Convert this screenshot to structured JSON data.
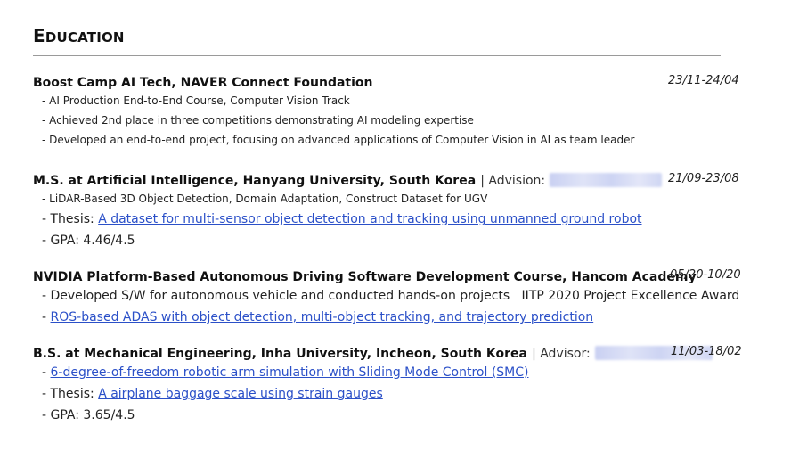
{
  "section": {
    "title_first": "E",
    "title_rest": "DUCATION"
  },
  "entries": [
    {
      "title": "Boost Camp AI Tech, NAVER Connect Foundation",
      "date": "23/11-24/04",
      "items": [
        "- AI Production End-to-End Course, Computer Vision Track",
        "- Achieved 2nd place in three competitions demonstrating AI modeling expertise",
        "- Developed an end-to-end project, focusing on advanced applications of Computer Vision in AI as team leader"
      ]
    },
    {
      "title": "M.S. at Artificial Intelligence, Hanyang University, South Korea",
      "suffix": "| Advision:",
      "date": "21/09-23/08",
      "items": [
        "- LiDAR-Based 3D Object Detection, Domain Adaptation, Construct Dataset for UGV"
      ],
      "thesis_prefix": "- Thesis:",
      "thesis_link": "A dataset for multi-sensor object detection and tracking using unmanned ground robot",
      "gpa": "- GPA: 4.46/4.5"
    },
    {
      "title": "NVIDIA Platform-Based Autonomous Driving Software Development Course, Hancom Academy",
      "date": "05/20-10/20",
      "item": "- Developed S/W for autonomous vehicle and conducted hands-on projects   IITP 2020 Project Excellence Award",
      "link_prefix": "-",
      "link": "ROS-based ADAS with object detection, multi-object tracking, and trajectory prediction"
    },
    {
      "title": "B.S. at Mechanical Engineering, Inha University, Incheon, South Korea",
      "suffix": "| Advisor:",
      "date": "11/03-18/02",
      "link_prefix": "-",
      "link": "6-degree-of-freedom robotic arm simulation with Sliding Mode Control (SMC)",
      "thesis_prefix": "- Thesis:",
      "thesis_link": "A airplane baggage scale using strain gauges",
      "gpa": "- GPA: 3.65/4.5"
    }
  ],
  "colors": {
    "link": "#2b50c8",
    "rule": "#9a9a9a",
    "text": "#1a1a1a"
  }
}
